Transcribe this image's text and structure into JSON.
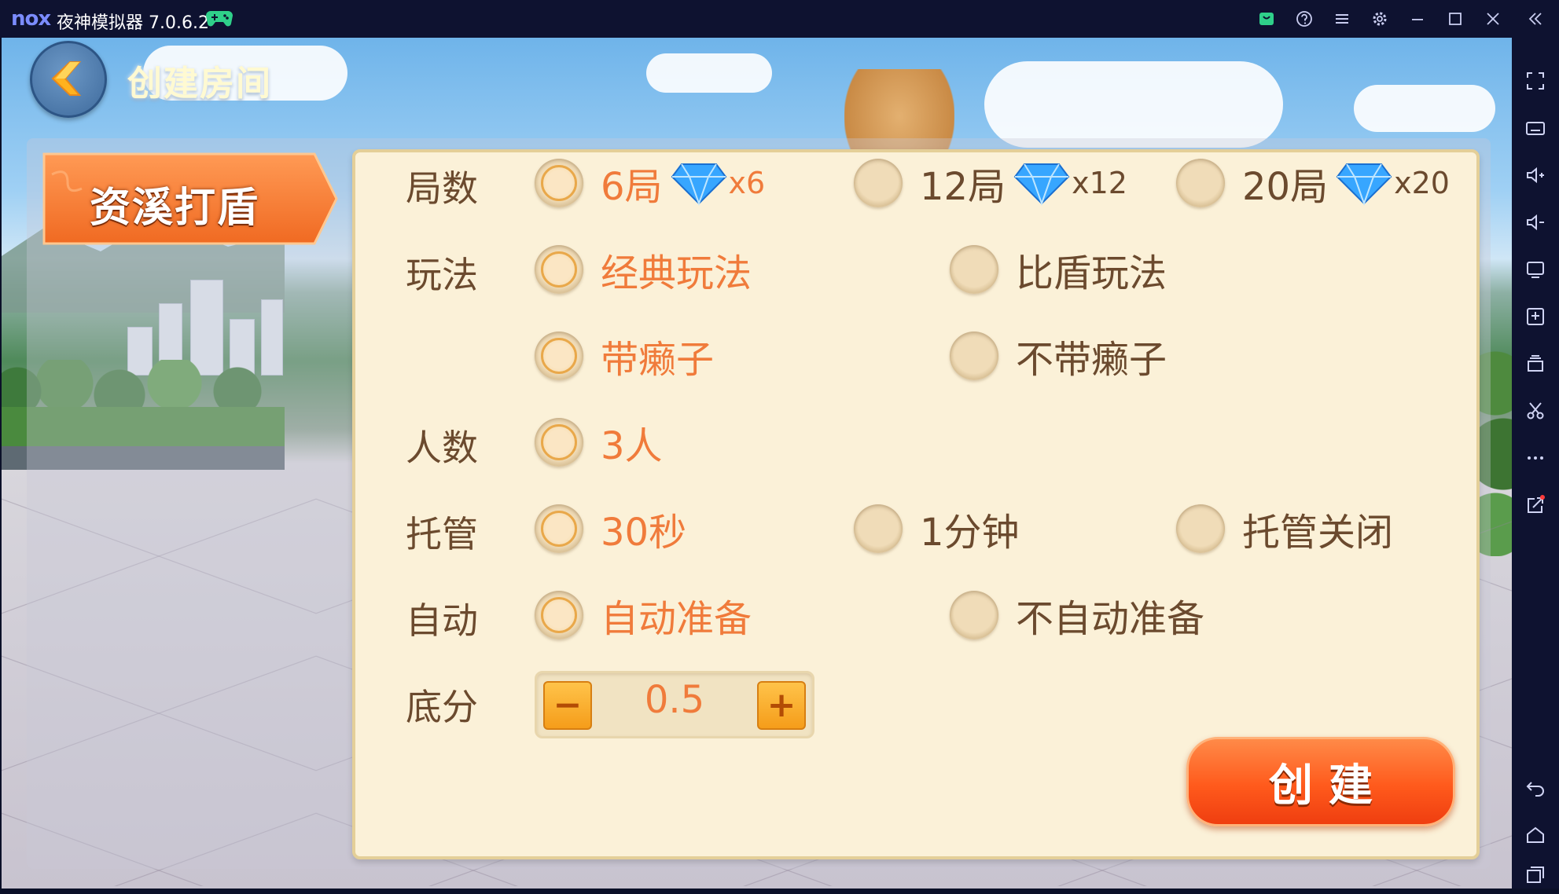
{
  "window": {
    "logo": "nox",
    "title": "夜神模拟器 7.0.6.2",
    "titlebar_icons": [
      "gamepad-icon",
      "store-icon",
      "help-icon",
      "menu-icon",
      "settings-icon",
      "minimize-icon",
      "maximize-icon",
      "close-icon",
      "collapse-icon"
    ]
  },
  "sidebar_icons": [
    "fullscreen-icon",
    "keyboard-icon",
    "volume-up-icon",
    "volume-down-icon",
    "screen-icon",
    "add-apk-icon",
    "multi-instance-icon",
    "screenshot-icon",
    "more-icon",
    "share-icon",
    "back-icon",
    "home-icon",
    "recent-apps-icon"
  ],
  "header": {
    "title": "创建房间"
  },
  "game_tab": {
    "label": "资溪打盾"
  },
  "rows": {
    "rounds": {
      "label": "局数",
      "options": [
        {
          "text": "6局",
          "cost": "x6",
          "selected": true
        },
        {
          "text": "12局",
          "cost": "x12",
          "selected": false
        },
        {
          "text": "20局",
          "cost": "x20",
          "selected": false
        }
      ]
    },
    "mode": {
      "label": "玩法",
      "options": [
        {
          "text": "经典玩法",
          "selected": true
        },
        {
          "text": "比盾玩法",
          "selected": false
        }
      ]
    },
    "wildcard": {
      "options": [
        {
          "text": "带癞子",
          "selected": true
        },
        {
          "text": "不带癞子",
          "selected": false
        }
      ]
    },
    "players": {
      "label": "人数",
      "options": [
        {
          "text": "3人",
          "selected": true
        }
      ]
    },
    "auto_play": {
      "label": "托管",
      "options": [
        {
          "text": "30秒",
          "selected": true
        },
        {
          "text": "1分钟",
          "selected": false
        },
        {
          "text": "托管关闭",
          "selected": false
        }
      ]
    },
    "auto_ready": {
      "label": "自动",
      "options": [
        {
          "text": "自动准备",
          "selected": true
        },
        {
          "text": "不自动准备",
          "selected": false
        }
      ]
    },
    "base_score": {
      "label": "底分",
      "value": "0.5",
      "minus": "−",
      "plus": "+"
    }
  },
  "create_button": {
    "label": "创建"
  },
  "colors": {
    "selected_text": "#f07b3b",
    "normal_text": "#6b4a2e",
    "card_bg": "#fbf1d8",
    "button_orange": "#ff5a1c"
  }
}
